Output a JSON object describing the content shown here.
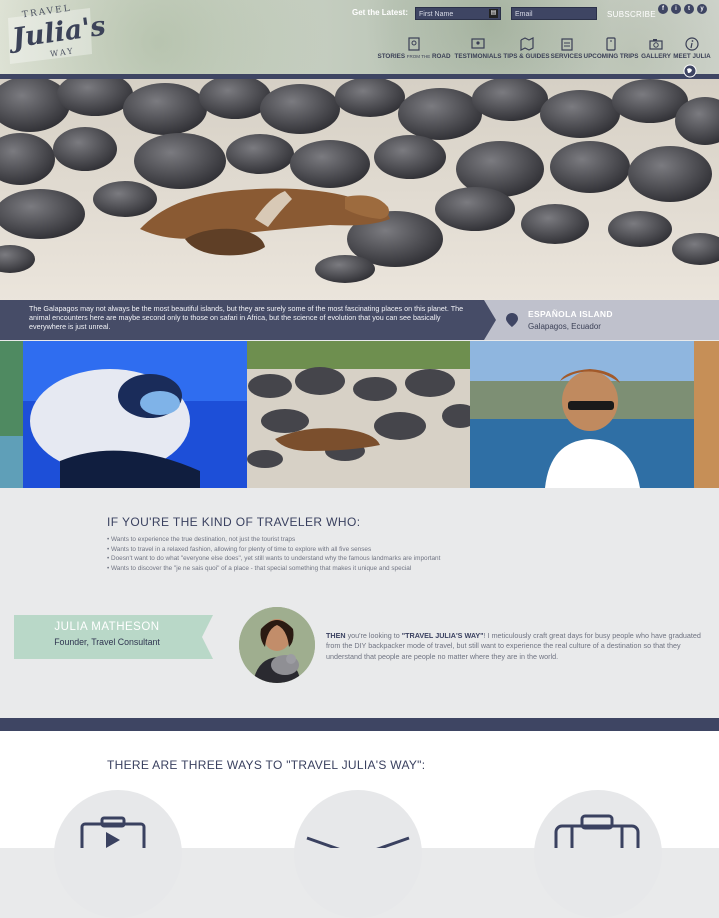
{
  "header": {
    "get_latest": "Get the Latest:",
    "first_name_placeholder": "First Name",
    "email_placeholder": "Email",
    "subscribe": "SUBSCRIBE",
    "social": [
      "f",
      "i",
      "t",
      "y"
    ],
    "logo": {
      "top": "TRAVEL",
      "main": "Julia's",
      "bottom": "WAY"
    }
  },
  "nav": [
    {
      "label": "STORIES",
      "small": "FROM THE",
      "label2": "ROAD",
      "icon": "stories-icon"
    },
    {
      "label": "TESTIMONIALS",
      "icon": "testimonials-icon"
    },
    {
      "label": "TIPS & GUIDES",
      "icon": "map-icon"
    },
    {
      "label": "SERVICES",
      "icon": "clipboard-icon"
    },
    {
      "label": "UPCOMING TRIPS",
      "icon": "phone-icon"
    },
    {
      "label": "GALLERY",
      "icon": "camera-icon"
    },
    {
      "label": "MEET JULIA",
      "icon": "info-icon"
    }
  ],
  "hero": {
    "caption": "The Galapagos may not always be the most beautiful islands, but they are surely some of the most fascinating places on this planet. The animal encounters here are maybe second only to those on safari in Africa, but the science of evolution that you can see basically everywhere is just unreal.",
    "location_name": "ESPAÑOLA ISLAND",
    "location_sub": "Galapagos, Ecuador"
  },
  "traveler": {
    "title": "IF YOU'RE THE KIND OF TRAVELER WHO:",
    "bullets": [
      "• Wants to experience the true destination, not just the tourist traps",
      "• Wants to travel in a relaxed fashion, allowing for plenty of time to explore with all five senses",
      "• Doesn't want to do what \"everyone else does\", yet still wants to understand why the famous landmarks are important",
      "• Wants to discover the \"je ne sais quoi\" of a place - that special something that makes it unique and special"
    ]
  },
  "profile": {
    "name": "JULIA MATHESON",
    "role": "Founder, Travel Consultant",
    "then_lead": "THEN",
    "then_mid": " you're looking to ",
    "then_quote": "\"TRAVEL JULIA'S WAY\"",
    "then_rest": "! I meticulously craft great days for busy people who have graduated from the DIY backpacker mode of travel, but still want to experience the real culture of a destination so that they understand that people are people no matter where they are in the world."
  },
  "ways": {
    "title": "THERE ARE THREE WAYS TO \"TRAVEL JULIA'S WAY\":"
  },
  "colors": {
    "navy": "#3e4563",
    "caption_bg": "#464c67",
    "ribbon": "#b8d8c8",
    "page_bg": "#e9eaeb"
  }
}
